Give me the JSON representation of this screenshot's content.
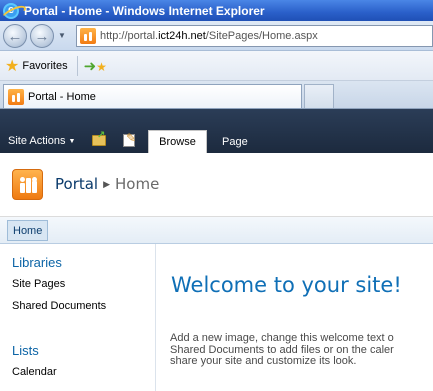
{
  "browser": {
    "window_title": "Portal - Home - Windows Internet Explorer",
    "url_prefix": "http://portal.",
    "url_host": "ict24h.net",
    "url_path": "/SitePages/Home.aspx",
    "favorites_label": "Favorites",
    "tab_title": "Portal - Home"
  },
  "ribbon": {
    "site_actions": "Site Actions",
    "tabs": [
      "Browse",
      "Page"
    ]
  },
  "site": {
    "name": "Portal",
    "page": "Home"
  },
  "topnav": {
    "home": "Home"
  },
  "quicklaunch": {
    "headings": [
      "Libraries",
      "Lists"
    ],
    "libraries": [
      "Site Pages",
      "Shared Documents"
    ],
    "lists": [
      "Calendar"
    ]
  },
  "main": {
    "welcome": "Welcome to your site!",
    "intro_lines": [
      "Add a new image, change this welcome text o",
      "Shared Documents to add files or on the caler",
      "share your site and customize its look."
    ]
  }
}
